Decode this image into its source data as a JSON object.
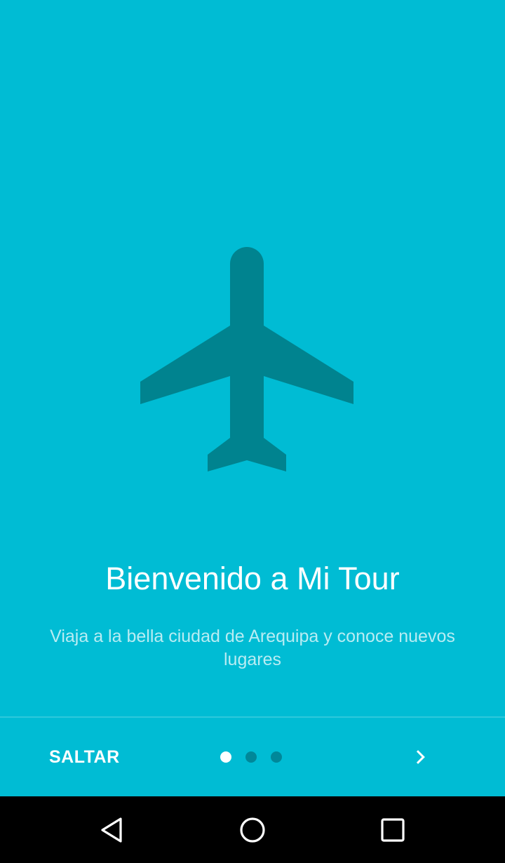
{
  "app": {
    "name": "Mi Tour"
  },
  "intro": {
    "icon": "airplane-icon",
    "title": "Bienvenido a Mi Tour",
    "description": "Viaja a la bella ciudad de Arequipa y conoce nuevos lugares",
    "current_page": 1,
    "total_pages": 3
  },
  "bottom_bar": {
    "skip_label": "SALTAR",
    "next_icon": "chevron-right-icon"
  },
  "system_nav": {
    "back_icon": "back-triangle-icon",
    "home_icon": "home-circle-icon",
    "recents_icon": "recents-square-icon"
  },
  "colors": {
    "background": "#00BCD4",
    "icon": "#00838F",
    "text": "#FFFFFF",
    "nav_bar": "#000000"
  }
}
